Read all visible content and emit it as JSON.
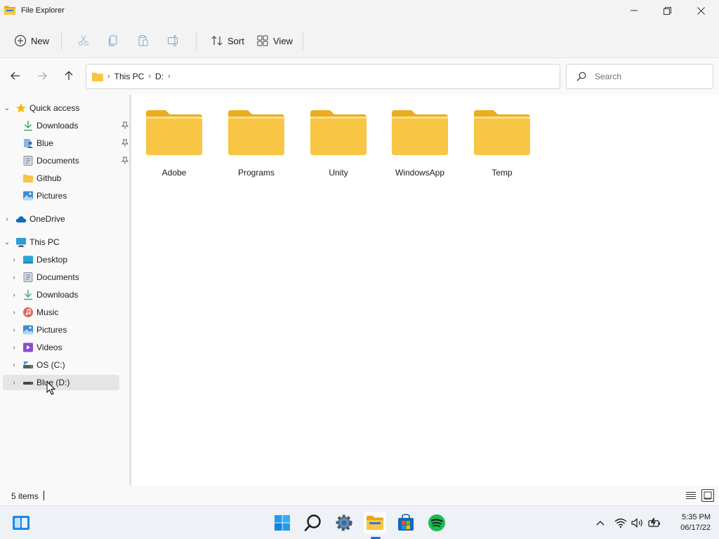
{
  "window": {
    "title": "File Explorer"
  },
  "toolbar": {
    "new_label": "New",
    "sort_label": "Sort",
    "view_label": "View"
  },
  "address": {
    "crumbs": [
      "This PC",
      "D:"
    ]
  },
  "search": {
    "placeholder": "Search"
  },
  "sidebar": {
    "quick_access": {
      "label": "Quick access",
      "items": [
        {
          "label": "Downloads",
          "icon": "download-icon",
          "pinned": true
        },
        {
          "label": "Blue",
          "icon": "user-folder-icon",
          "pinned": true
        },
        {
          "label": "Documents",
          "icon": "documents-icon",
          "pinned": true
        },
        {
          "label": "Github",
          "icon": "folder-icon",
          "pinned": false
        },
        {
          "label": "Pictures",
          "icon": "pictures-icon",
          "pinned": false
        }
      ]
    },
    "onedrive": {
      "label": "OneDrive"
    },
    "this_pc": {
      "label": "This PC",
      "items": [
        {
          "label": "Desktop",
          "icon": "desktop-icon"
        },
        {
          "label": "Documents",
          "icon": "documents-icon"
        },
        {
          "label": "Downloads",
          "icon": "download-icon"
        },
        {
          "label": "Music",
          "icon": "music-icon"
        },
        {
          "label": "Pictures",
          "icon": "pictures-icon"
        },
        {
          "label": "Videos",
          "icon": "videos-icon"
        },
        {
          "label": "OS (C:)",
          "icon": "drive-c-icon"
        },
        {
          "label": "Blue (D:)",
          "icon": "drive-d-icon",
          "selected": true
        }
      ]
    }
  },
  "folders": [
    {
      "label": "Adobe"
    },
    {
      "label": "Programs"
    },
    {
      "label": "Unity"
    },
    {
      "label": "WindowsApp"
    },
    {
      "label": "Temp"
    }
  ],
  "status": {
    "items_count": "5 items"
  },
  "taskbar": {
    "apps": [
      "widgets-icon",
      "start-icon",
      "search-icon",
      "settings-icon",
      "file-explorer-icon",
      "store-icon",
      "spotify-icon"
    ],
    "active_app": "file-explorer-icon"
  },
  "tray": {
    "time": "5:35 PM",
    "date": "06/17/22"
  },
  "colors": {
    "folder": "#f8c544",
    "accent": "#1a6fd8",
    "spotify": "#1db954"
  }
}
